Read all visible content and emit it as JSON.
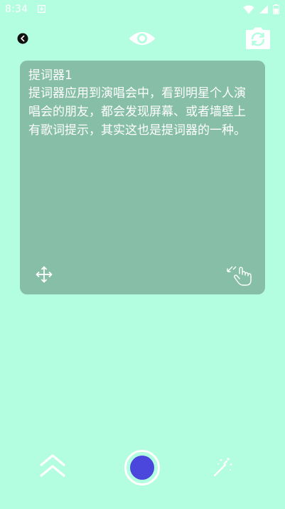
{
  "status_bar": {
    "time": "8:34",
    "notification_icon": "download-notification-icon",
    "wifi_icon": "wifi-icon",
    "signal_icon": "cell-signal-icon",
    "battery_icon": "battery-icon"
  },
  "toolbar": {
    "back_icon": "back-arrow-icon",
    "preview_icon": "eye-icon",
    "switch_camera_icon": "camera-switch-icon"
  },
  "prompter": {
    "title": "提词器1",
    "content": "提词器应用到演唱会中，看到明星个人演唱会的朋友，都会发现屏幕、或者墙壁上有歌词提示，其实这也是提词器的一种。",
    "move_icon": "move-arrows-icon",
    "resize_icon": "resize-hand-icon",
    "card_color": "#86bea7"
  },
  "bottom_bar": {
    "scroll_icon": "double-chevron-up-icon",
    "record_icon": "record-icon",
    "effects_icon": "magic-wand-icon",
    "record_color": "#4b47dc"
  },
  "theme": {
    "background": "#b3fde1"
  }
}
